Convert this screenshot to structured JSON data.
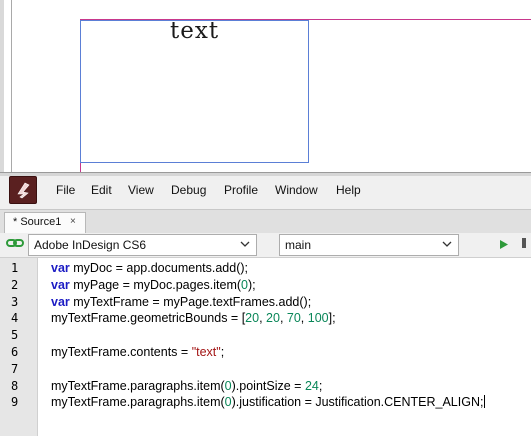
{
  "document": {
    "frame_text": "text"
  },
  "menu": {
    "items": [
      "File",
      "Edit",
      "View",
      "Debug",
      "Profile",
      "Window",
      "Help"
    ]
  },
  "tabs": [
    {
      "label": "* Source1",
      "close": "×"
    }
  ],
  "toolbar": {
    "target_app": "Adobe InDesign CS6",
    "engine": "main"
  },
  "editor": {
    "line_numbers": [
      "1",
      "2",
      "3",
      "4",
      "5",
      "6",
      "7",
      "8",
      "9"
    ],
    "lines": [
      [
        {
          "t": "var",
          "c": "kw"
        },
        {
          "t": " myDoc = app.documents.add();",
          "c": "p"
        }
      ],
      [
        {
          "t": "var",
          "c": "kw"
        },
        {
          "t": " myPage = myDoc.pages.item(",
          "c": "p"
        },
        {
          "t": "0",
          "c": "num"
        },
        {
          "t": ");",
          "c": "p"
        }
      ],
      [
        {
          "t": "var",
          "c": "kw"
        },
        {
          "t": " myTextFrame = myPage.textFrames.add();",
          "c": "p"
        }
      ],
      [
        {
          "t": "myTextFrame.geometricBounds = [",
          "c": "p"
        },
        {
          "t": "20",
          "c": "num"
        },
        {
          "t": ", ",
          "c": "p"
        },
        {
          "t": "20",
          "c": "num"
        },
        {
          "t": ", ",
          "c": "p"
        },
        {
          "t": "70",
          "c": "num"
        },
        {
          "t": ", ",
          "c": "p"
        },
        {
          "t": "100",
          "c": "num"
        },
        {
          "t": "];",
          "c": "p"
        }
      ],
      [],
      [
        {
          "t": "myTextFrame.contents = ",
          "c": "p"
        },
        {
          "t": "\"text\"",
          "c": "str"
        },
        {
          "t": ";",
          "c": "p"
        }
      ],
      [],
      [
        {
          "t": "myTextFrame.paragraphs.item(",
          "c": "p"
        },
        {
          "t": "0",
          "c": "num"
        },
        {
          "t": ").pointSize = ",
          "c": "p"
        },
        {
          "t": "24",
          "c": "num"
        },
        {
          "t": ";",
          "c": "p"
        }
      ],
      [
        {
          "t": "myTextFrame.paragraphs.item(",
          "c": "p"
        },
        {
          "t": "0",
          "c": "num"
        },
        {
          "t": ").justification = Justification.CENTER_ALIGN;",
          "c": "p"
        }
      ]
    ]
  },
  "colors": {
    "keyword": "#1c1cc4",
    "string": "#a31515",
    "number": "#098658",
    "page_margin": "#c8378c",
    "frame_border": "#5b7fd6",
    "run_button": "#2e9a3a"
  },
  "icons": [
    "estk-app-icon",
    "link-icon",
    "chevron-down-icon",
    "play-icon",
    "stop-icon",
    "close-icon"
  ]
}
